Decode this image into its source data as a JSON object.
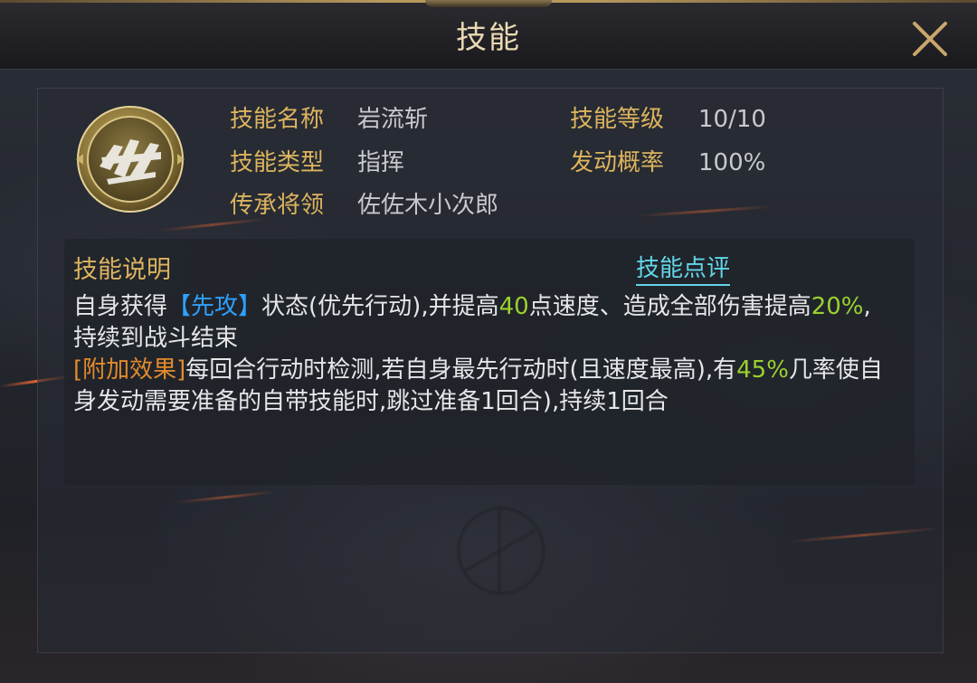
{
  "header": {
    "title": "技能"
  },
  "skill": {
    "icon": "skill-emblem-icon",
    "fields": [
      {
        "label": "技能名称",
        "value": "岩流斩"
      },
      {
        "label": "技能等级",
        "value": "10/10"
      },
      {
        "label": "技能类型",
        "value": "指挥"
      },
      {
        "label": "发动概率",
        "value": "100%"
      },
      {
        "label": "传承将领",
        "value": "佐佐木小次郎"
      }
    ]
  },
  "description": {
    "title": "技能说明",
    "review_link": "技能点评",
    "p1": {
      "a": "自身获得",
      "tag": "【先攻】",
      "b": "状态(优先行动),并提高",
      "speed": "40",
      "c": "点速度、造成全部伤害提高",
      "dmg": "20%",
      "d": ",持续到战斗结束"
    },
    "p2": {
      "tag": "[附加效果]",
      "a": "每回合行动时检测,若自身最先行动时(且速度最高),有",
      "chance": "45%",
      "b": "几率使自身发动需要准备的自带技能时,跳过准备1回合),持续1回合"
    }
  },
  "colors": {
    "label_gold": "#dcb45e",
    "value_gray": "#c9c9cd",
    "keyword_blue": "#2ea0ff",
    "number_green": "#9bd12e",
    "effect_orange": "#e28a2c",
    "link_cyan": "#62d6e8"
  }
}
